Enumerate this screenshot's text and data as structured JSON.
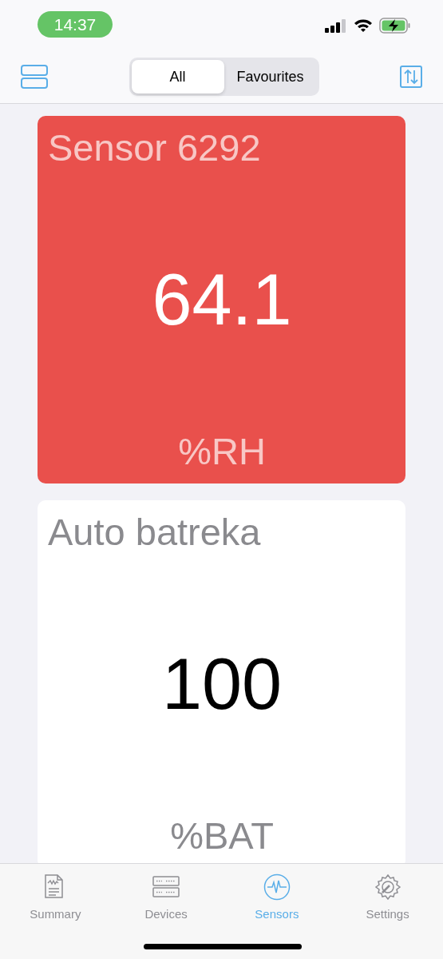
{
  "status_bar": {
    "time": "14:37"
  },
  "segments": [
    {
      "label": "All",
      "selected": true
    },
    {
      "label": "Favourites",
      "selected": false
    }
  ],
  "sensors": [
    {
      "title": "Sensor 6292",
      "value": "64.1",
      "unit": "%RH",
      "alert": true
    },
    {
      "title": "Auto batreka",
      "value": "100",
      "unit": "%BAT",
      "alert": false
    }
  ],
  "tab_bar": [
    {
      "label": "Summary",
      "kind": "summary",
      "selected": false
    },
    {
      "label": "Devices",
      "kind": "devices",
      "selected": false
    },
    {
      "label": "Sensors",
      "kind": "sensors",
      "selected": true
    },
    {
      "label": "Settings",
      "kind": "settings",
      "selected": false
    }
  ]
}
